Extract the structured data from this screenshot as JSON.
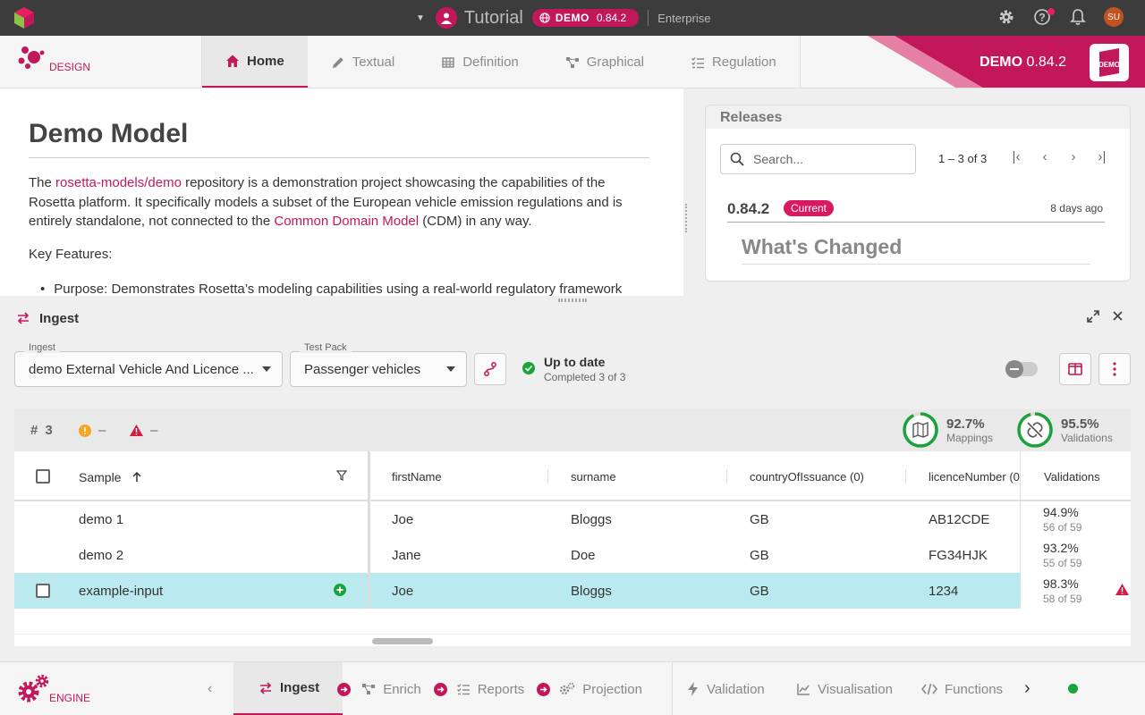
{
  "topbar": {
    "project_title": "Tutorial",
    "badge_label": "DEMO",
    "badge_version": "0.84.2",
    "edition": "Enterprise",
    "user_initials": "SU",
    "icons": [
      "settings-icon",
      "help-icon",
      "notifications-icon"
    ]
  },
  "navbar": {
    "design_label": "DESIGN",
    "tabs": [
      {
        "label": "Home",
        "icon": "home-icon",
        "active": true
      },
      {
        "label": "Textual",
        "icon": "pencil-icon"
      },
      {
        "label": "Definition",
        "icon": "table-icon"
      },
      {
        "label": "Graphical",
        "icon": "graph-icon"
      },
      {
        "label": "Regulation",
        "icon": "checklist-icon"
      }
    ],
    "banner_name": "DEMO",
    "banner_version": "0.84.2",
    "banner_logo_text": "DEMO"
  },
  "doc": {
    "title": "Demo Model",
    "p1_a": "The ",
    "p1_link1": "rosetta-models/demo",
    "p1_b": " repository is a demonstration project showcasing the capabilities of the Rosetta platform. It specifically models a subset of the European vehicle emission regulations and is entirely standalone, not connected to the ",
    "p1_link2": "Common Domain Model",
    "p1_c": " (CDM) in any way.",
    "p2": "Key Features:",
    "li1": "Purpose: Demonstrates Rosetta’s modeling capabilities using a real-world regulatory framework"
  },
  "releases": {
    "title": "Releases",
    "search_placeholder": "Search...",
    "pagination": "1 – 3 of 3",
    "version": "0.84.2",
    "current_label": "Current",
    "date": "8 days ago",
    "changed_title": "What's Changed"
  },
  "ingest": {
    "panel_title": "Ingest",
    "ingest_label": "Ingest",
    "ingest_value": "demo External Vehicle And Licence ...",
    "testpack_label": "Test Pack",
    "testpack_value": "Passenger vehicles",
    "status_title": "Up to date",
    "status_sub": "Completed 3 of 3",
    "count_symbol": "#",
    "count": "3",
    "warn_count": "–",
    "error_count": "–",
    "mappings_pct": "92.7%",
    "mappings_label": "Mappings",
    "mappings_fraction": 0.927,
    "validations_pct": "95.5%",
    "validations_label": "Validations",
    "validations_fraction": 0.955
  },
  "table": {
    "headers": {
      "sample": "Sample",
      "firstName": "firstName",
      "surname": "surname",
      "country": "countryOfIssuance (0)",
      "licence": "licenceNumber (0",
      "validations": "Validations"
    },
    "rows": [
      {
        "sample": "demo 1",
        "firstName": "Joe",
        "surname": "Bloggs",
        "country": "GB",
        "licence": "AB12CDE",
        "val_pct": "94.9%",
        "val_sub": "56 of 59"
      },
      {
        "sample": "demo 2",
        "firstName": "Jane",
        "surname": "Doe",
        "country": "GB",
        "licence": "FG34HJK",
        "val_pct": "93.2%",
        "val_sub": "55 of 59"
      },
      {
        "sample": "example-input",
        "firstName": "Joe",
        "surname": "Bloggs",
        "country": "GB",
        "licence": "1234",
        "val_pct": "98.3%",
        "val_sub": "58 of 59"
      }
    ]
  },
  "engine": {
    "label": "ENGINE",
    "tabs": [
      "Ingest",
      "Enrich",
      "Reports",
      "Projection"
    ],
    "tools": [
      "Validation",
      "Visualisation",
      "Functions"
    ]
  },
  "colors": {
    "accent": "#c2185b",
    "topbar": "#3c3c3c",
    "selected_row": "#bbe9f0",
    "ok_green": "#1aa33a"
  }
}
